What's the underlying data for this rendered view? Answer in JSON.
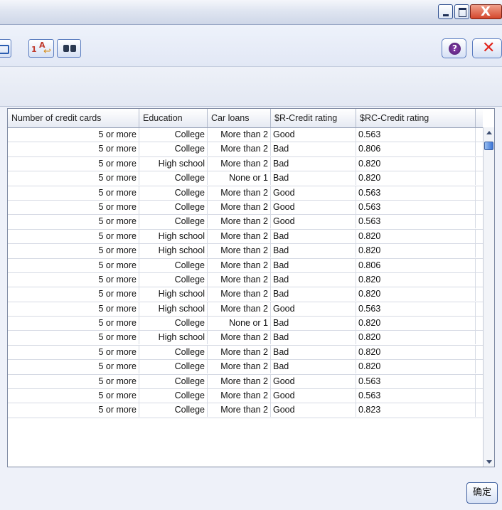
{
  "window": {
    "controls": {
      "minimize_icon": "minimize-icon",
      "maximize_icon": "maximize-icon",
      "close_glyph": "X"
    }
  },
  "toolbar": {
    "icons": [
      "print-icon",
      "sort-icon",
      "find-icon",
      "help-icon",
      "close-icon"
    ],
    "help_glyph": "?",
    "close_glyph": "✕",
    "sort_digit": "1",
    "sort_letter": "A"
  },
  "table": {
    "columns": [
      "Number of credit cards",
      "Education",
      "Car loans",
      "$R-Credit rating",
      "$RC-Credit rating"
    ],
    "rows": [
      [
        "5 or more",
        "College",
        "More than 2",
        "Good",
        "0.563"
      ],
      [
        "5 or more",
        "College",
        "More than 2",
        "Bad",
        "0.806"
      ],
      [
        "5 or more",
        "High school",
        "More than 2",
        "Bad",
        "0.820"
      ],
      [
        "5 or more",
        "College",
        "None or 1",
        "Bad",
        "0.820"
      ],
      [
        "5 or more",
        "College",
        "More than 2",
        "Good",
        "0.563"
      ],
      [
        "5 or more",
        "College",
        "More than 2",
        "Good",
        "0.563"
      ],
      [
        "5 or more",
        "College",
        "More than 2",
        "Good",
        "0.563"
      ],
      [
        "5 or more",
        "High school",
        "More than 2",
        "Bad",
        "0.820"
      ],
      [
        "5 or more",
        "High school",
        "More than 2",
        "Bad",
        "0.820"
      ],
      [
        "5 or more",
        "College",
        "More than 2",
        "Bad",
        "0.806"
      ],
      [
        "5 or more",
        "College",
        "More than 2",
        "Bad",
        "0.820"
      ],
      [
        "5 or more",
        "High school",
        "More than 2",
        "Bad",
        "0.820"
      ],
      [
        "5 or more",
        "High school",
        "More than 2",
        "Good",
        "0.563"
      ],
      [
        "5 or more",
        "College",
        "None or 1",
        "Bad",
        "0.820"
      ],
      [
        "5 or more",
        "High school",
        "More than 2",
        "Bad",
        "0.820"
      ],
      [
        "5 or more",
        "College",
        "More than 2",
        "Bad",
        "0.820"
      ],
      [
        "5 or more",
        "College",
        "More than 2",
        "Bad",
        "0.820"
      ],
      [
        "5 or more",
        "College",
        "More than 2",
        "Good",
        "0.563"
      ],
      [
        "5 or more",
        "College",
        "More than 2",
        "Good",
        "0.563"
      ],
      [
        "5 or more",
        "College",
        "More than 2",
        "Good",
        "0.823"
      ]
    ]
  },
  "footer": {
    "ok_label": "确定"
  },
  "colors": {
    "title_close": "#d4472b",
    "toolbar_close": "#e1251b",
    "help": "#6a2c8f",
    "scroll_thumb": "#3a73d6"
  }
}
